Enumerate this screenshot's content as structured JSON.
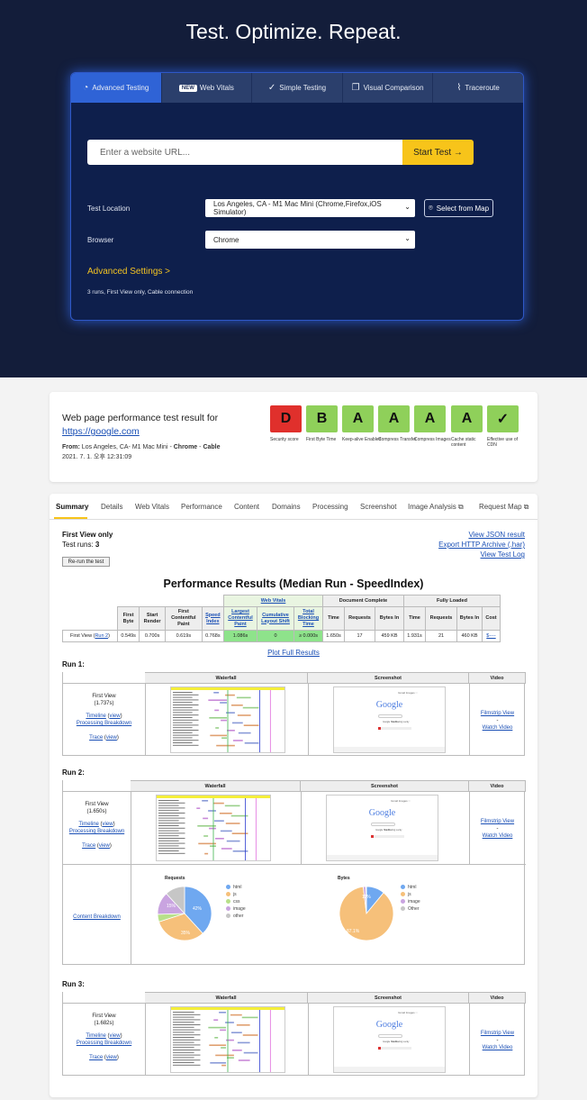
{
  "hero": {
    "title": "Test. Optimize. Repeat."
  },
  "tabs": [
    {
      "label": "Advanced Testing",
      "icon": "gauge-icon"
    },
    {
      "label": "Web Vitals",
      "badge": "NEW"
    },
    {
      "label": "Simple Testing",
      "icon": "check-circle-icon"
    },
    {
      "label": "Visual Comparison",
      "icon": "copy-icon"
    },
    {
      "label": "Traceroute",
      "icon": "route-icon"
    }
  ],
  "form": {
    "url_placeholder": "Enter a website URL...",
    "start_label": "Start Test →",
    "location_label": "Test Location",
    "location_value": "Los Angeles, CA - M1 Mac Mini (Chrome,Firefox,iOS Simulator)",
    "map_label": "Select from Map",
    "browser_label": "Browser",
    "browser_value": "Chrome",
    "advanced_label": "Advanced Settings  >",
    "summary": "3 runs, First View only, Cable connection"
  },
  "result": {
    "title": "Web page performance test result for",
    "url": "https://google.com",
    "from_label": "From:",
    "from_location": "Los Angeles, CA- M1 Mac Mini -",
    "from_browser": "Chrome",
    "from_sep": "-",
    "from_connection": "Cable",
    "date": "2021. 7. 1. 오후 12:31:09",
    "grades": [
      {
        "grade": "D",
        "label": "Security score",
        "color": "#e0302c"
      },
      {
        "grade": "B",
        "label": "First Byte Time",
        "color": "#8fd05a"
      },
      {
        "grade": "A",
        "label": "Keep-alive Enabled",
        "color": "#8fd05a"
      },
      {
        "grade": "A",
        "label": "Compress Transfer",
        "color": "#8fd05a"
      },
      {
        "grade": "A",
        "label": "Compress Images",
        "color": "#8fd05a"
      },
      {
        "grade": "A",
        "label": "Cache static content",
        "color": "#8fd05a"
      },
      {
        "grade": "✓",
        "label": "Effective use of CDN",
        "color": "#8fd05a"
      }
    ]
  },
  "result_tabs": [
    "Summary",
    "Details",
    "Web Vitals",
    "Performance",
    "Content",
    "Domains",
    "Processing",
    "Screenshot",
    "Image Analysis ⧉",
    "Request Map ⧉"
  ],
  "summary": {
    "first_view_only": "First View only",
    "test_runs_label": "Test runs:",
    "test_runs": "3",
    "rerun": "Re-run the test",
    "links": [
      "View JSON result",
      "Export HTTP Archive (.har)",
      "View Test Log"
    ],
    "perf_title": "Performance Results (Median Run - SpeedIndex)",
    "table": {
      "groups": [
        "Web Vitals",
        "Document Complete",
        "Fully Loaded"
      ],
      "headers": [
        "First Byte",
        "Start Render",
        "First Contentful Paint",
        "Speed Index",
        "Largest Contentful Paint",
        "Cumulative Layout Shift",
        "Total Blocking Time",
        "Time",
        "Requests",
        "Bytes In",
        "Time",
        "Requests",
        "Bytes In",
        "Cost"
      ],
      "row_label": "First View (",
      "row_link": "Run 2",
      "row_label_end": ")",
      "values": [
        "0.549s",
        "0.700s",
        "0.619s",
        "0.768s",
        "1.086s",
        "0",
        "≥ 0.000s",
        "1.650s",
        "17",
        "459 KB",
        "1.931s",
        "21",
        "460 KB",
        "$----"
      ]
    },
    "plot_link": "Plot Full Results"
  },
  "runs": [
    {
      "label": "Run 1:",
      "view": "First View",
      "time": "(1.737s)"
    },
    {
      "label": "Run 2:",
      "view": "First View",
      "time": "(1.650s)"
    },
    {
      "label": "Run 3:",
      "view": "First View",
      "time": "(1.682s)"
    }
  ],
  "run_links": {
    "timeline": "Timeline",
    "view": "view",
    "processing": "Processing Breakdown",
    "trace": "Trace",
    "filmstrip": "Filmstrip View",
    "dash": "-",
    "watch": "Watch Video",
    "content_breakdown": "Content Breakdown"
  },
  "run_headers": [
    "Waterfall",
    "Screenshot",
    "Video"
  ],
  "screenshot_text": {
    "google": "Google",
    "menu": "Gmail  Images  :::",
    "btn1": "Google Search",
    "btn2": "I'm Feeling Lucky"
  },
  "pies": {
    "requests_title": "Requests",
    "bytes_title": "Bytes",
    "requests_legend": [
      "html",
      "js",
      "css",
      "image",
      "other"
    ],
    "bytes_legend": [
      "html",
      "js",
      "image",
      "Other"
    ],
    "requests_labels": [
      "42%",
      "35%",
      "15%"
    ],
    "bytes_labels": [
      "11%",
      "87.1%"
    ]
  },
  "chart_data": [
    {
      "type": "pie",
      "title": "Requests",
      "categories": [
        "html",
        "js",
        "css",
        "image",
        "other"
      ],
      "values": [
        42,
        35,
        5,
        15,
        13
      ],
      "colors": [
        "#6fa8f0",
        "#f6c07a",
        "#b8e08a",
        "#c9a4e0",
        "#c6c6c6"
      ]
    },
    {
      "type": "pie",
      "title": "Bytes",
      "categories": [
        "html",
        "js",
        "image",
        "Other"
      ],
      "values": [
        11,
        87.1,
        1.5,
        0.4
      ],
      "colors": [
        "#6fa8f0",
        "#f6c07a",
        "#c9a4e0",
        "#c6c6c6"
      ]
    }
  ]
}
